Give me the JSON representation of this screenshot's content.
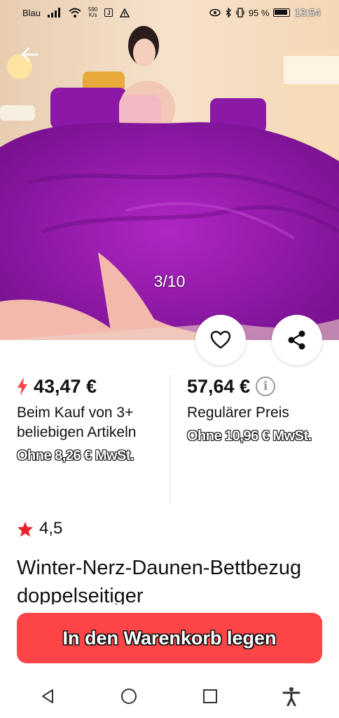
{
  "status_bar": {
    "carrier": "Blau",
    "speed_value": "590",
    "speed_unit": "K/s",
    "battery": "95 %",
    "time": "13:54",
    "sim_icon": "J"
  },
  "gallery": {
    "counter": "3/10",
    "image_colors": {
      "fur": "#9d1fb0",
      "fur_dark": "#6c0e86",
      "lining": "#f3b9ac",
      "wall": "#f1d9c0"
    }
  },
  "price_left": {
    "price": "43,47 €",
    "condition": "Beim Kauf von 3+ beliebigen Artikeln",
    "vat": "Ohne 8,26 € MwSt."
  },
  "price_right": {
    "price": "57,64 €",
    "label": "Regulärer Preis",
    "vat": "Ohne 10,96 € MwSt."
  },
  "rating": {
    "value": "4,5"
  },
  "product": {
    "title": "Winter-Nerz-Daunen-Bettbezug doppelseitiger"
  },
  "cta": {
    "label": "In den Warenkorb legen"
  },
  "colors": {
    "accent": "#fd4447",
    "star": "#e8242b"
  }
}
